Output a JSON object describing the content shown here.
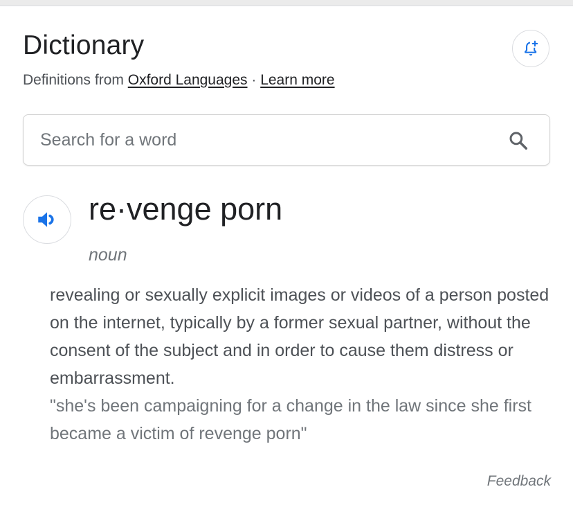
{
  "header": {
    "title": "Dictionary",
    "subtitle_prefix": "Definitions from",
    "source_link": "Oxford Languages",
    "separator": " · ",
    "learn_more_link": "Learn more",
    "alert_icon": "bell-plus-icon"
  },
  "search": {
    "placeholder": "Search for a word",
    "value": "",
    "icon": "search-icon"
  },
  "entry": {
    "pronounce_icon": "speaker-icon",
    "headword": "re·venge porn",
    "part_of_speech": "noun",
    "definition": "revealing or sexually explicit images or videos of a person posted on the internet, typically by a former sexual partner, without the consent of the subject and in order to cause them distress or embarrassment.",
    "example": "\"she's been campaigning for a change in the law since she first became a victim of revenge porn\""
  },
  "footer": {
    "feedback_label": "Feedback"
  },
  "colors": {
    "accent_blue": "#1a73e8",
    "text_primary": "#202124",
    "text_secondary": "#4d5156",
    "text_muted": "#70757a",
    "border": "#dadce0"
  }
}
